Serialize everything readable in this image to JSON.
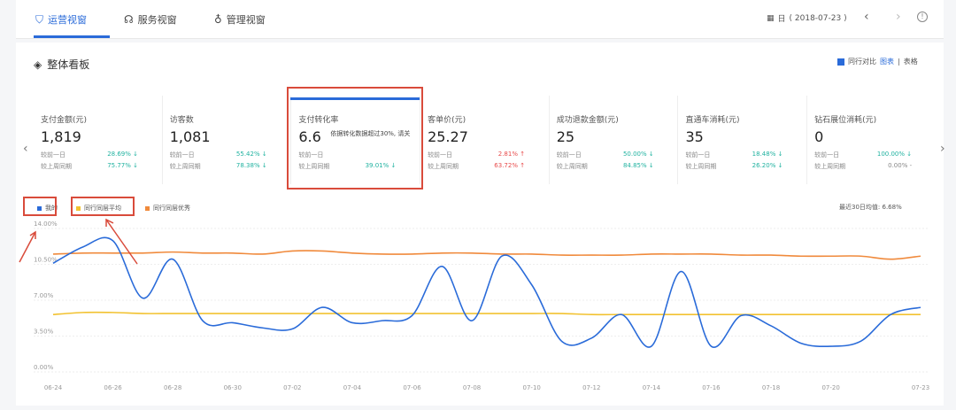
{
  "nav": {
    "tabs": [
      {
        "icon": "shield-icon",
        "glyph": "⛉",
        "label": "运营视窗"
      },
      {
        "icon": "headset-icon",
        "glyph": "☊",
        "label": "服务视窗"
      },
      {
        "icon": "lock-icon",
        "glyph": "♁",
        "label": "管理视窗"
      }
    ],
    "date_prefix": "日",
    "date": "( 2018-07-23 )",
    "prev": "‹",
    "next": "›"
  },
  "panel": {
    "title": "整体看板",
    "compare_label": "同行对比",
    "view_chart": "图表",
    "view_sep": "|",
    "view_table": "表格"
  },
  "cards": [
    {
      "label": "支付金额(元)",
      "value": "1,819",
      "rows": [
        {
          "k": "较前一日",
          "v": "28.69%",
          "dir": "down"
        },
        {
          "k": "较上周同期",
          "v": "75.77%",
          "dir": "down"
        }
      ]
    },
    {
      "label": "访客数",
      "value": "1,081",
      "rows": [
        {
          "k": "较前一日",
          "v": "55.42%",
          "dir": "down"
        },
        {
          "k": "较上周同期",
          "v": "78.38%",
          "dir": "down"
        }
      ]
    },
    {
      "label": "支付转化率",
      "value": "6.6",
      "rows": [
        {
          "k": "较前一日",
          "v": "",
          "dir": ""
        },
        {
          "k": "较上周同期",
          "v": "39.01%",
          "dir": "down"
        }
      ]
    },
    {
      "label": "客单价(元)",
      "value": "25.27",
      "rows": [
        {
          "k": "较前一日",
          "v": "2.81%",
          "dir": "up"
        },
        {
          "k": "较上周同期",
          "v": "63.72%",
          "dir": "up"
        }
      ]
    },
    {
      "label": "成功退款金额(元)",
      "value": "25",
      "rows": [
        {
          "k": "较前一日",
          "v": "50.00%",
          "dir": "down"
        },
        {
          "k": "较上周同期",
          "v": "84.85%",
          "dir": "down"
        }
      ]
    },
    {
      "label": "直通车消耗(元)",
      "value": "35",
      "rows": [
        {
          "k": "较前一日",
          "v": "18.48%",
          "dir": "down"
        },
        {
          "k": "较上周同期",
          "v": "26.20%",
          "dir": "down"
        }
      ]
    },
    {
      "label": "钻石展位消耗(元)",
      "value": "0",
      "rows": [
        {
          "k": "较前一日",
          "v": "100.00%",
          "dir": "down"
        },
        {
          "k": "较上周同期",
          "v": "0.00%",
          "dir": "flat"
        }
      ]
    }
  ],
  "tooltip": "依据转化数据超过30%, 请关",
  "legend": [
    {
      "name": "我的",
      "color": "#2a6bd9"
    },
    {
      "name": "同行同层平均",
      "color": "#f2c230"
    },
    {
      "name": "同行同层优秀",
      "color": "#f08a3c"
    }
  ],
  "avg_note": "最近30日均值: 6.68%",
  "chart_data": {
    "type": "line",
    "yticks": [
      "14.00%",
      "10.50%",
      "7.00%",
      "3.50%",
      "0.00%"
    ],
    "ylim": [
      0,
      14
    ],
    "x": [
      "06-24",
      "06-25",
      "06-26",
      "06-27",
      "06-28",
      "06-29",
      "06-30",
      "07-01",
      "07-02",
      "07-03",
      "07-04",
      "07-05",
      "07-06",
      "07-07",
      "07-08",
      "07-09",
      "07-10",
      "07-11",
      "07-12",
      "07-13",
      "07-14",
      "07-15",
      "07-16",
      "07-17",
      "07-18",
      "07-19",
      "07-20",
      "07-21",
      "07-22",
      "07-23"
    ],
    "xticks": [
      "06-24",
      "06-26",
      "06-28",
      "06-30",
      "07-02",
      "07-04",
      "07-06",
      "07-08",
      "07-10",
      "07-12",
      "07-14",
      "07-16",
      "07-18",
      "07-20",
      "07-23"
    ],
    "series": [
      {
        "name": "我的",
        "color": "#2a6bd9",
        "values": [
          10.6,
          12.2,
          12.8,
          7.2,
          11.0,
          5.0,
          4.8,
          4.3,
          4.2,
          6.3,
          4.8,
          5.0,
          5.5,
          10.3,
          5.0,
          11.3,
          8.5,
          3.0,
          3.3,
          5.6,
          2.5,
          9.8,
          2.5,
          5.5,
          4.5,
          2.8,
          2.5,
          3.0,
          5.6,
          6.3
        ]
      },
      {
        "name": "同行同层平均",
        "color": "#f2c230",
        "values": [
          5.6,
          5.8,
          5.8,
          5.7,
          5.7,
          5.7,
          5.7,
          5.7,
          5.7,
          5.7,
          5.7,
          5.7,
          5.7,
          5.7,
          5.7,
          5.7,
          5.7,
          5.7,
          5.6,
          5.6,
          5.6,
          5.6,
          5.6,
          5.6,
          5.6,
          5.6,
          5.6,
          5.6,
          5.6,
          5.6
        ]
      },
      {
        "name": "同行同层优秀",
        "color": "#f08a3c",
        "values": [
          11.5,
          11.6,
          11.6,
          11.6,
          11.7,
          11.6,
          11.6,
          11.5,
          11.8,
          11.8,
          11.6,
          11.5,
          11.5,
          11.6,
          11.6,
          11.5,
          11.5,
          11.4,
          11.4,
          11.4,
          11.5,
          11.5,
          11.5,
          11.4,
          11.4,
          11.3,
          11.3,
          11.3,
          11.0,
          11.3
        ]
      }
    ]
  }
}
